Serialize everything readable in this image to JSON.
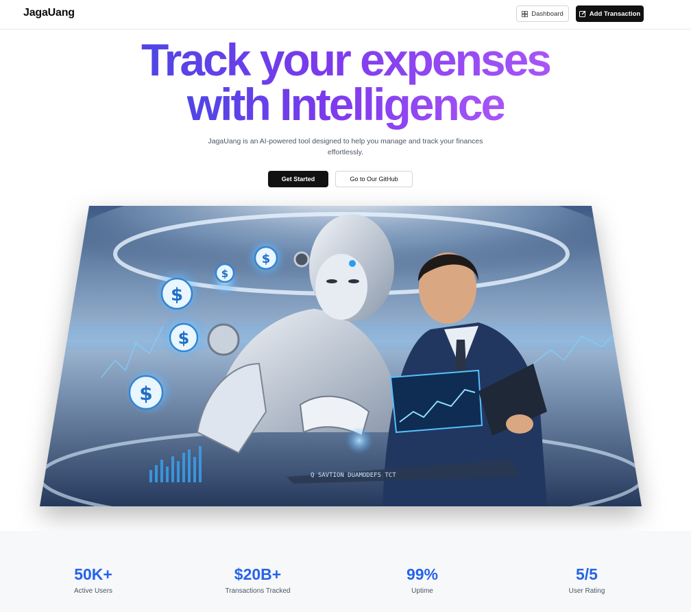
{
  "app": {
    "brand": "JagaUang"
  },
  "nav": {
    "dashboard_label": "Dashboard",
    "add_transaction_label": "Add Transaction",
    "dashboard_icon": "layout-dashboard-icon",
    "add_transaction_icon": "pencil-square-icon"
  },
  "hero": {
    "title_line1": "Track your expenses",
    "title_line2": "with Intelligence",
    "subtitle": "JagaUang is an AI-powered tool designed to help you manage and track your finances effortlessly.",
    "primary_cta": "Get Started",
    "secondary_cta": "Go to Our GitHub",
    "image_caption": "Q SAVTION DUAMODEFS TCT"
  },
  "stats": [
    {
      "value": "50K+",
      "label": "Active Users"
    },
    {
      "value": "$20B+",
      "label": "Transactions Tracked"
    },
    {
      "value": "99%",
      "label": "Uptime"
    },
    {
      "value": "5/5",
      "label": "User Rating"
    }
  ],
  "colors": {
    "gradient_start": "#4f46e5",
    "gradient_end": "#a855f7",
    "stat_accent": "#2563eb",
    "primary_button": "#111111"
  }
}
